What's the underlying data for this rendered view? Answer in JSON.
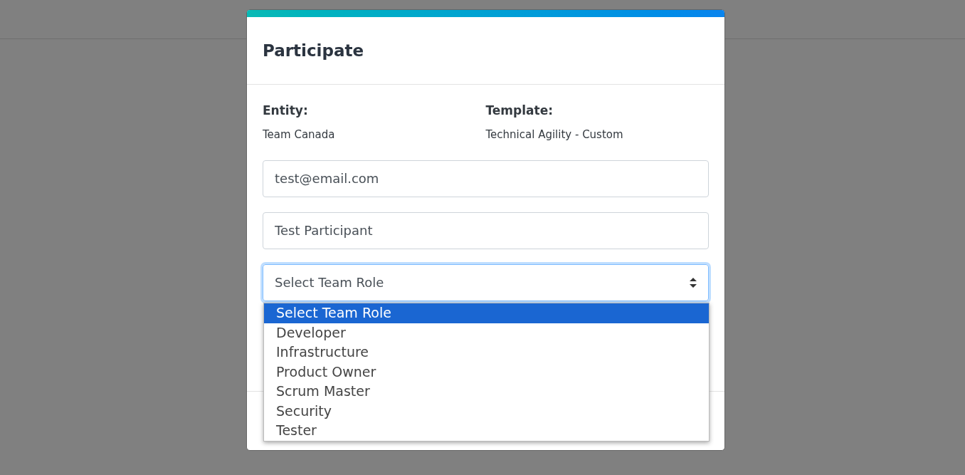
{
  "dialog": {
    "title": "Participate"
  },
  "details": [
    {
      "label": "Entity:",
      "value": "Team Canada"
    },
    {
      "label": "Template:",
      "value": "Technical Agility - Custom"
    }
  ],
  "fields": [
    {
      "kind": "input",
      "value": "test@email.com"
    },
    {
      "kind": "input",
      "value": "Test Participant"
    },
    {
      "kind": "select",
      "value": "Select Team Role",
      "focused": true
    }
  ],
  "dropdown": {
    "options": [
      {
        "label": "Select Team Role",
        "selected": true
      },
      {
        "label": "Developer",
        "selected": false
      },
      {
        "label": "Infrastructure",
        "selected": false
      },
      {
        "label": "Product Owner",
        "selected": false
      },
      {
        "label": "Scrum Master",
        "selected": false
      },
      {
        "label": "Security",
        "selected": false
      },
      {
        "label": "Tester",
        "selected": false
      }
    ]
  }
}
